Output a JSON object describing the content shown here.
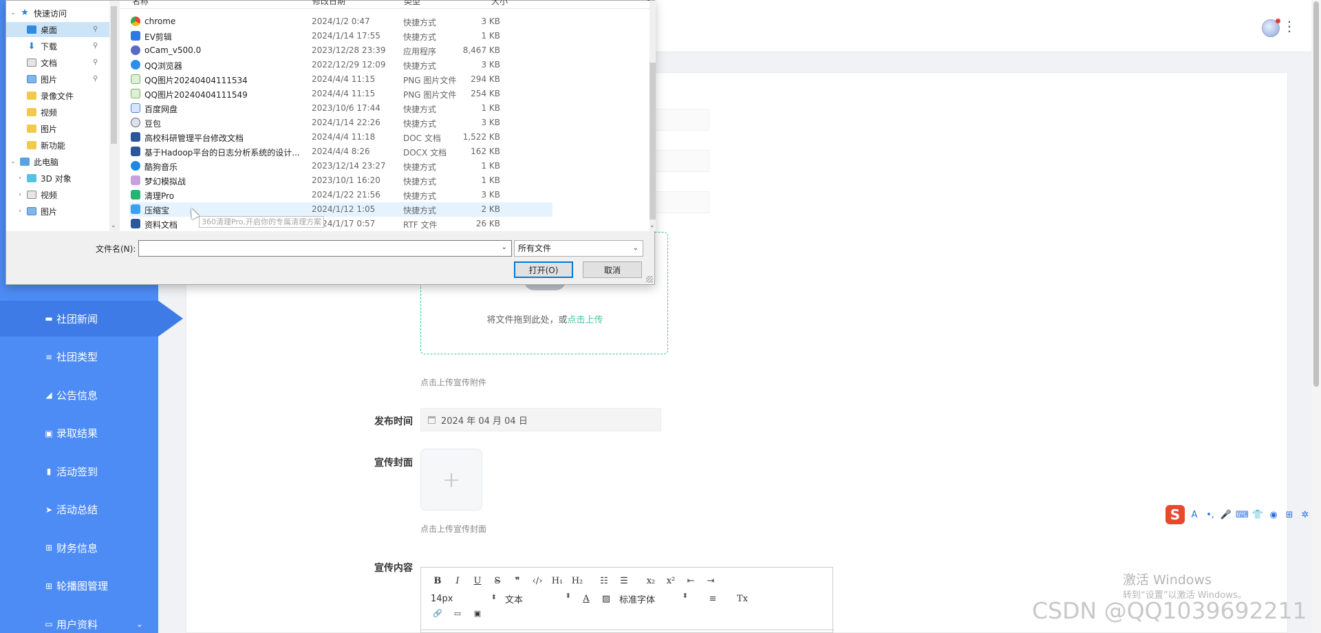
{
  "sidebar": {
    "items": [
      {
        "label": "社团新闻",
        "icon": "briefcase-icon",
        "glyph": "▬",
        "active": true
      },
      {
        "label": "社团类型",
        "icon": "list-icon",
        "glyph": "≡",
        "active": false
      },
      {
        "label": "公告信息",
        "icon": "bullhorn-icon",
        "glyph": "◢",
        "active": false
      },
      {
        "label": "录取结果",
        "icon": "picture-icon",
        "glyph": "▣",
        "active": false
      },
      {
        "label": "活动签到",
        "icon": "bar-chart-icon",
        "glyph": "▮",
        "active": false
      },
      {
        "label": "活动总结",
        "icon": "send-icon",
        "glyph": "➤",
        "active": false
      },
      {
        "label": "财务信息",
        "icon": "grid-icon",
        "glyph": "⊞",
        "active": false
      },
      {
        "label": "轮播图管理",
        "icon": "grid-icon",
        "glyph": "⊞",
        "active": false
      },
      {
        "label": "用户资料",
        "icon": "calendar-icon",
        "glyph": "▭",
        "active": false,
        "expandable": true
      }
    ]
  },
  "header": {
    "avatar_icon": "user-avatar-icon",
    "more_icon": "more-vertical-icon"
  },
  "form": {
    "upload_hint": "将文件拖到此处，或",
    "upload_link": "点击上传",
    "attachment_note": "点击上传宣传附件",
    "publish_time_label": "发布时间",
    "publish_time_value": "2024 年 04 月 04 日",
    "cover_label": "宣传封面",
    "cover_note": "点击上传宣传封面",
    "content_label": "宣传内容",
    "editor": {
      "row1": [
        "B",
        "I",
        "U",
        "S",
        "❞",
        "‹/›",
        "H₁",
        "H₂",
        "☷",
        "☰",
        "x₂",
        "x²",
        "⇤",
        "⇥"
      ],
      "size": "14px",
      "block": "文本",
      "font": "标准字体",
      "row2_tail": [
        "A",
        "▨",
        "≡",
        "Tx"
      ],
      "row3": [
        "🔗",
        "▭",
        "▣"
      ]
    }
  },
  "colors": {
    "sidebar": "#4d8cf5",
    "sidebar_active": "#3f7be6",
    "accent": "#3ec6a3"
  },
  "watermarks": {
    "activate_title": "激活 Windows",
    "activate_sub": "转到“设置”以激活 Windows。",
    "csdn": "CSDN @QQ1039692211"
  },
  "ime_bar": [
    "A",
    "•,",
    "🎤",
    "⌨",
    "👕",
    "◉",
    "⊞",
    "✲"
  ],
  "dialog": {
    "close_glyph": "✕",
    "nav": [
      {
        "label": "快速访问",
        "icon": "star-icon",
        "level": 0,
        "twisty": "⌄"
      },
      {
        "label": "桌面",
        "icon": "desktop-icon",
        "level": 1,
        "pinned": true,
        "selected": true
      },
      {
        "label": "下载",
        "icon": "download-icon",
        "level": 1,
        "pinned": true
      },
      {
        "label": "文档",
        "icon": "document-icon",
        "level": 1,
        "pinned": true
      },
      {
        "label": "图片",
        "icon": "picture-icon",
        "level": 1,
        "pinned": true
      },
      {
        "label": "录像文件",
        "icon": "folder-icon",
        "level": 1
      },
      {
        "label": "视频",
        "icon": "folder-icon",
        "level": 1
      },
      {
        "label": "图片",
        "icon": "folder-icon",
        "level": 1
      },
      {
        "label": "新功能",
        "icon": "folder-icon",
        "level": 1
      },
      {
        "label": "此电脑",
        "icon": "computer-icon",
        "level": 0,
        "twisty": "⌄"
      },
      {
        "label": "3D 对象",
        "icon": "cube-icon",
        "level": 1,
        "twisty": "›"
      },
      {
        "label": "视频",
        "icon": "video-folder-icon",
        "level": 1,
        "twisty": "›"
      },
      {
        "label": "图片",
        "icon": "picture-icon",
        "level": 1,
        "twisty": "›"
      }
    ],
    "columns": {
      "name": "名称",
      "date": "修改日期",
      "type": "类型",
      "size": "大小"
    },
    "files": [
      {
        "name": "chrome",
        "date": "2024/1/2 0:47",
        "type": "快捷方式",
        "size": "3 KB",
        "icon": "chrome"
      },
      {
        "name": "EV剪辑",
        "date": "2024/1/14 17:55",
        "type": "快捷方式",
        "size": "1 KB",
        "icon": "ev"
      },
      {
        "name": "oCam_v500.0",
        "date": "2023/12/28 23:39",
        "type": "应用程序",
        "size": "8,467 KB",
        "icon": "ocam"
      },
      {
        "name": "QQ浏览器",
        "date": "2022/12/29 12:09",
        "type": "快捷方式",
        "size": "3 KB",
        "icon": "qqb"
      },
      {
        "name": "QQ图片20240404111534",
        "date": "2024/4/4 11:15",
        "type": "PNG 图片文件",
        "size": "294 KB",
        "icon": "png"
      },
      {
        "name": "QQ图片20240404111549",
        "date": "2024/4/4 11:15",
        "type": "PNG 图片文件",
        "size": "254 KB",
        "icon": "png"
      },
      {
        "name": "百度网盘",
        "date": "2023/10/6 17:44",
        "type": "快捷方式",
        "size": "1 KB",
        "icon": "baidu"
      },
      {
        "name": "豆包",
        "date": "2024/1/14 22:26",
        "type": "快捷方式",
        "size": "3 KB",
        "icon": "doubao"
      },
      {
        "name": "高校科研管理平台修改文档",
        "date": "2024/4/4 11:18",
        "type": "DOC 文档",
        "size": "1,522 KB",
        "icon": "docx"
      },
      {
        "name": "基于Hadoop平台的日志分析系统的设计...",
        "date": "2024/4/4 8:26",
        "type": "DOCX 文档",
        "size": "162 KB",
        "icon": "docx"
      },
      {
        "name": "酷狗音乐",
        "date": "2023/12/14 23:27",
        "type": "快捷方式",
        "size": "1 KB",
        "icon": "kugou"
      },
      {
        "name": "梦幻模拟战",
        "date": "2023/10/1 16:20",
        "type": "快捷方式",
        "size": "1 KB",
        "icon": "game"
      },
      {
        "name": "清理Pro",
        "date": "2024/1/22 21:56",
        "type": "快捷方式",
        "size": "3 KB",
        "icon": "clean"
      },
      {
        "name": "压缩宝",
        "date": "2024/1/12 1:05",
        "type": "快捷方式",
        "size": "2 KB",
        "icon": "zip",
        "hover": true
      },
      {
        "name": "资料文档",
        "date": "2024/1/17 0:57",
        "type": "RTF 文件",
        "size": "26 KB",
        "icon": "rtf"
      }
    ],
    "tooltip": "360清理Pro,开启你的专属清理方案",
    "filename_label": "文件名(N):",
    "filename_value": "",
    "filetype_value": "所有文件",
    "open_button": "打开(O)",
    "cancel_button": "取消"
  }
}
